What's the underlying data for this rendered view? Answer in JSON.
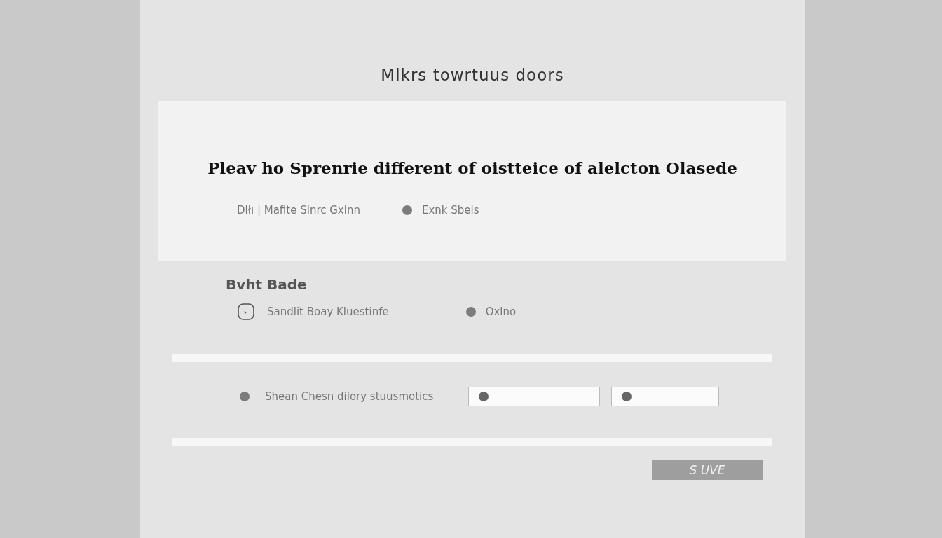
{
  "page": {
    "title": "Mlkrs towrtuus doors"
  },
  "question_card": {
    "question": "Pleav ho Sprenrie different of oistteice of alelcton Olasede",
    "options": [
      {
        "kind": "plain",
        "label": "Dlłı | Mafite Sinrc Gxlnn"
      },
      {
        "kind": "dot",
        "label": "Exnk Sbeis"
      }
    ]
  },
  "section": {
    "heading": "Bvht Bade",
    "items": [
      {
        "kind": "icon",
        "label": "Sandlit Boay Kluestinfe"
      },
      {
        "kind": "dot",
        "label": "Oxlno"
      }
    ]
  },
  "field_row": {
    "label": "Shean Chesn dilory stuusmotics",
    "fields": [
      {
        "kind": "dot"
      },
      {
        "kind": "dot"
      }
    ]
  },
  "button": {
    "label": "S UVE"
  }
}
